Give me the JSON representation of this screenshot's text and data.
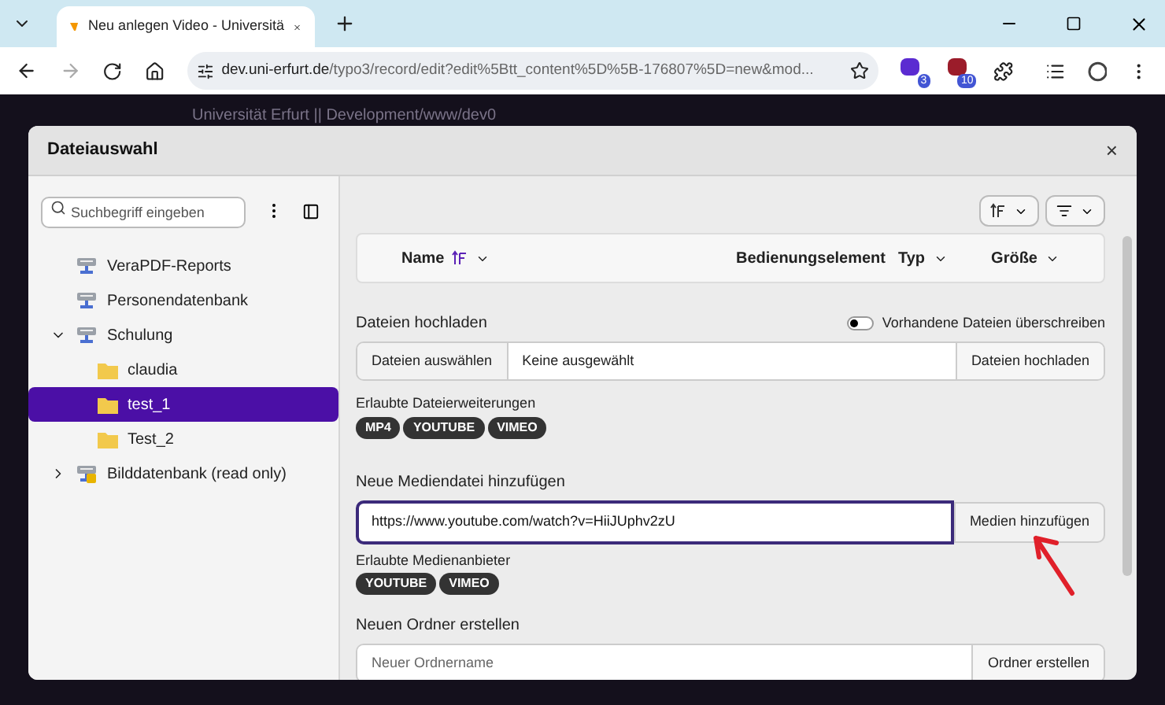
{
  "browser": {
    "tab_title": "Neu anlegen Video - Universitä",
    "url_host": "dev.uni-erfurt.de",
    "url_path": "/typo3/record/edit?edit%5Btt_content%5D%5B-176807%5D=new&mod...",
    "extension_badges": [
      "3",
      "10"
    ]
  },
  "background_title": "Universität Erfurt || Development/www/dev0",
  "dialog": {
    "title": "Dateiauswahl",
    "close": "×"
  },
  "sidebar": {
    "search": {
      "placeholder": "Suchbegriff eingeben"
    },
    "tree": [
      {
        "label": "VeraPDF-Reports",
        "kind": "storage",
        "selected": false
      },
      {
        "label": "Personendatenbank",
        "kind": "storage",
        "selected": false
      },
      {
        "label": "Schulung",
        "kind": "storage",
        "selected": false,
        "expanded": true,
        "children": [
          {
            "label": "claudia",
            "kind": "folder",
            "selected": false
          },
          {
            "label": "test_1",
            "kind": "folder",
            "selected": true
          },
          {
            "label": "Test_2",
            "kind": "folder",
            "selected": false
          }
        ]
      },
      {
        "label": "Bilddatenbank (read only)",
        "kind": "storage-readonly",
        "selected": false,
        "expanded": false
      }
    ]
  },
  "table": {
    "columns": [
      {
        "label": "Name",
        "sorted": true
      },
      {
        "label": "Bedienungselement",
        "sortable": false
      },
      {
        "label": "Typ",
        "sortable": true
      },
      {
        "label": "Größe",
        "sortable": true
      }
    ]
  },
  "upload": {
    "title": "Dateien hochladen",
    "overwrite": {
      "label": "Vorhandene Dateien überschreiben",
      "on": false
    },
    "choose_button": "Dateien auswählen",
    "file_value": "Keine ausgewählt",
    "upload_button": "Dateien hochladen",
    "allowed_label": "Erlaubte Dateierweiterungen",
    "allowed": [
      "MP4",
      "YOUTUBE",
      "VIMEO"
    ]
  },
  "media": {
    "title": "Neue Mediendatei hinzufügen",
    "value": "https://www.youtube.com/watch?v=HiiJUphv2zU",
    "button": "Medien hinzufügen",
    "allowed_label": "Erlaubte Medienanbieter",
    "allowed": [
      "YOUTUBE",
      "VIMEO"
    ]
  },
  "folder": {
    "title": "Neuen Ordner erstellen",
    "placeholder": "Neuer Ordnername",
    "button": "Ordner erstellen"
  }
}
